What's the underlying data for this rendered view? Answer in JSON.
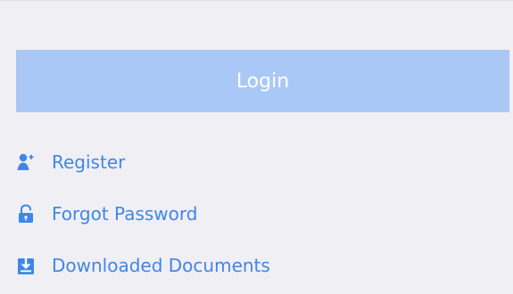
{
  "login": {
    "label": "Login"
  },
  "links": [
    {
      "label": "Register",
      "icon": "user-plus-icon"
    },
    {
      "label": "Forgot Password",
      "icon": "unlock-icon"
    },
    {
      "label": "Downloaded Documents",
      "icon": "download-icon"
    }
  ],
  "colors": {
    "background": "#f0eff4",
    "button": "#aac8f6",
    "link": "#3f86ea",
    "button_text": "#ffffff"
  }
}
